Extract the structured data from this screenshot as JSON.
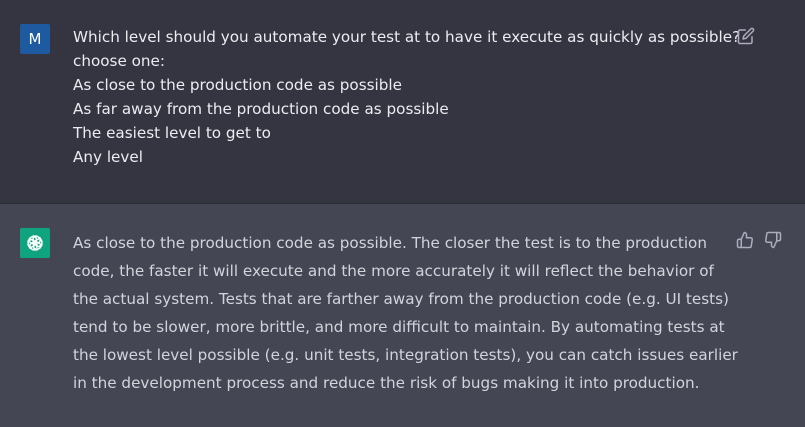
{
  "user_message": {
    "avatar_letter": "M",
    "lines": [
      "Which level should you automate your test at to have it execute as quickly as possible?",
      "choose one:",
      "As close to the production code as possible",
      "As far away from the production code as possible",
      "The easiest level to get to",
      "Any level"
    ],
    "edit_icon": "edit-icon"
  },
  "assistant_message": {
    "avatar_icon": "openai-logo-icon",
    "text": "As close to the production code as possible. The closer the test is to the production code, the faster it will execute and the more accurately it will reflect the behavior of the actual system. Tests that are farther away from the production code (e.g. UI tests) tend to be slower, more brittle, and more difficult to maintain. By automating tests at the lowest level possible (e.g. unit tests, integration tests), you can catch issues earlier in the development process and reduce the risk of bugs making it into production.",
    "feedback_icons": [
      "thumbs-up-icon",
      "thumbs-down-icon"
    ]
  },
  "colors": {
    "user_bg": "#343541",
    "assistant_bg": "#444654",
    "user_avatar": "#1e5aa0",
    "bot_avatar": "#10a37f"
  }
}
